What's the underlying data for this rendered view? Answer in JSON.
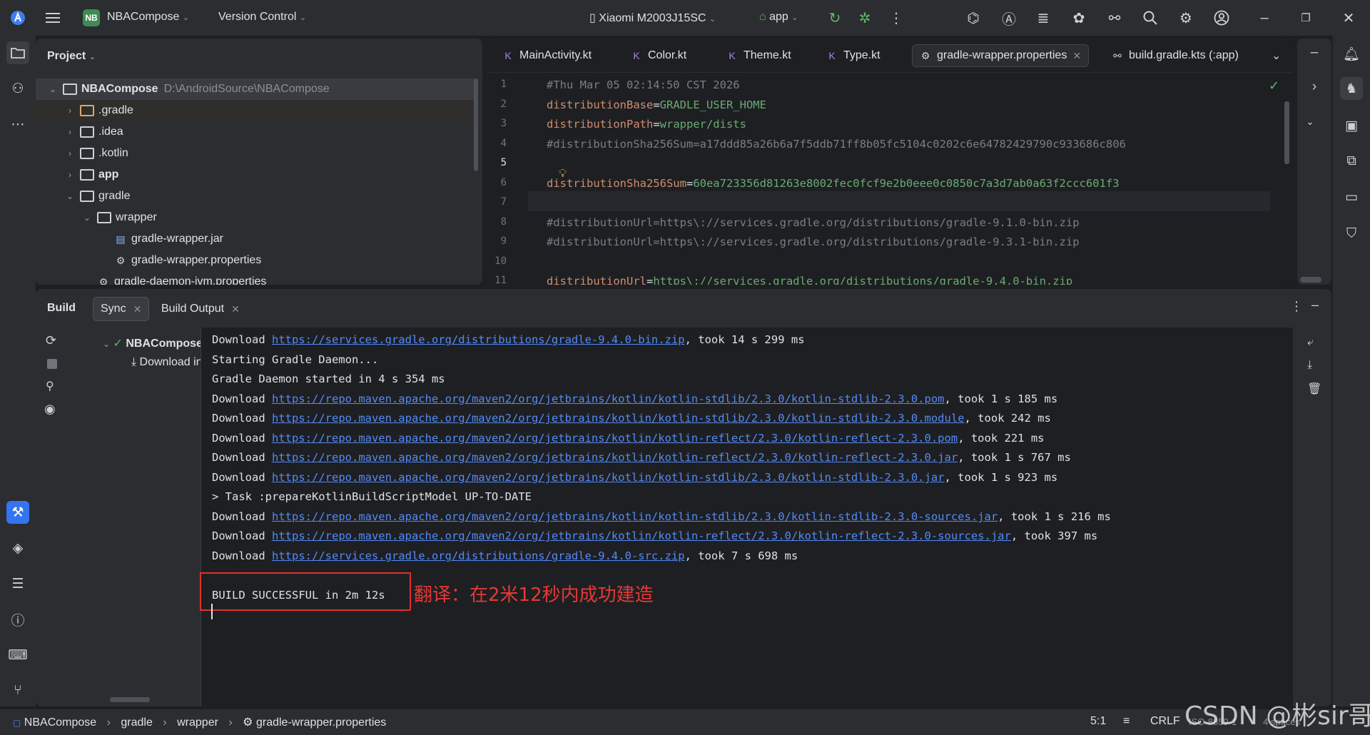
{
  "titlebar": {
    "project_badge": "NB",
    "project_name": "NBACompose",
    "vcs": "Version Control",
    "device": "Xiaomi M2003J15SC",
    "run_config": "app"
  },
  "project_panel": {
    "title": "Project",
    "root_name": "NBACompose",
    "root_path": "D:\\AndroidSource\\NBACompose",
    "items": [
      {
        "label": ".gradle"
      },
      {
        "label": ".idea"
      },
      {
        "label": ".kotlin"
      },
      {
        "label": "app"
      },
      {
        "label": "gradle"
      },
      {
        "label": "wrapper"
      },
      {
        "label": "gradle-wrapper.jar"
      },
      {
        "label": "gradle-wrapper.properties"
      },
      {
        "label": "gradle-daemon-jvm.properties"
      }
    ]
  },
  "editor": {
    "tabs": [
      {
        "label": "MainActivity.kt"
      },
      {
        "label": "Color.kt"
      },
      {
        "label": "Theme.kt"
      },
      {
        "label": "Type.kt"
      },
      {
        "label": "gradle-wrapper.properties"
      },
      {
        "label": "build.gradle.kts (:app)"
      }
    ],
    "line_numbers": [
      "1",
      "2",
      "3",
      "4",
      "5",
      "6",
      "7",
      "8",
      "9",
      "10",
      "11"
    ],
    "lines": {
      "l1": "#Thu Mar 05 02:14:50 CST 2026",
      "l2_key": "distributionBase",
      "l2_val": "GRADLE_USER_HOME",
      "l3_key": "distributionPath",
      "l3_val": "wrapper/dists",
      "l4": "#distributionSha256Sum=a17ddd85a26b6a7f5ddb71ff8b05fc5104c0202c6e64782429790c933686c806",
      "l6_key": "distributionSha256Sum",
      "l6_val": "60ea723356d81263e8002fec0fcf9e2b0eee0c0850c7a3d7ab0a63f2ccc601f3",
      "l8": "#distributionUrl=https\\://services.gradle.org/distributions/gradle-9.1.0-bin.zip",
      "l9": "#distributionUrl=https\\://services.gradle.org/distributions/gradle-9.3.1-bin.zip",
      "l11_key": "distributionUrl",
      "l11_val": "https\\://services.gradle.org/distributions/gradle-9.4.0-bin.zip"
    },
    "eq": "="
  },
  "build_panel": {
    "title": "Build",
    "tabs": [
      {
        "label": "Sync"
      },
      {
        "label": "Build Output"
      }
    ],
    "tree_root": "NBACompose: f",
    "tree_child": "Download in",
    "console": {
      "word_download": "Download",
      "l1_url": "https://services.gradle.org/distributions/gradle-9.4.0-bin.zip",
      "l1_rest": ", took 14 s 299 ms",
      "l2": "Starting Gradle Daemon...",
      "l3": "Gradle Daemon started in 4 s 354 ms",
      "l4_url": "https://repo.maven.apache.org/maven2/org/jetbrains/kotlin/kotlin-stdlib/2.3.0/kotlin-stdlib-2.3.0.pom",
      "l4_rest": ", took 1 s 185 ms",
      "l5_url": "https://repo.maven.apache.org/maven2/org/jetbrains/kotlin/kotlin-stdlib/2.3.0/kotlin-stdlib-2.3.0.module",
      "l5_rest": ", took 242 ms",
      "l6_url": "https://repo.maven.apache.org/maven2/org/jetbrains/kotlin/kotlin-reflect/2.3.0/kotlin-reflect-2.3.0.pom",
      "l6_rest": ", took 221 ms",
      "l7_url": "https://repo.maven.apache.org/maven2/org/jetbrains/kotlin/kotlin-reflect/2.3.0/kotlin-reflect-2.3.0.jar",
      "l7_rest": ", took 1 s 767 ms",
      "l8_url": "https://repo.maven.apache.org/maven2/org/jetbrains/kotlin/kotlin-stdlib/2.3.0/kotlin-stdlib-2.3.0.jar",
      "l8_rest": ", took 1 s 923 ms",
      "l9": "> Task :prepareKotlinBuildScriptModel UP-TO-DATE",
      "l10_url": "https://repo.maven.apache.org/maven2/org/jetbrains/kotlin/kotlin-stdlib/2.3.0/kotlin-stdlib-2.3.0-sources.jar",
      "l10_rest": ", took 1 s 216 ms",
      "l11_url": "https://repo.maven.apache.org/maven2/org/jetbrains/kotlin/kotlin-reflect/2.3.0/kotlin-reflect-2.3.0-sources.jar",
      "l11_rest": ", took 397 ms",
      "l12_url": "https://services.gradle.org/distributions/gradle-9.4.0-src.zip",
      "l12_rest": ", took 7 s 698 ms",
      "success": "BUILD SUCCESSFUL in 2m 12s"
    },
    "annotation": "翻译：在2米12秒内成功建造"
  },
  "statusbar": {
    "crumbs": [
      "NBACompose",
      "gradle",
      "wrapper",
      "gradle-wrapper.properties"
    ],
    "position": "5:1",
    "line_sep": "CRLF",
    "encoding": "ISO-8859-1",
    "indent": "4 spaces"
  },
  "watermark": "CSDN @彬sir哥",
  "colors": {
    "accent": "#3574f0",
    "success": "#5fb865",
    "annotation": "#e53935"
  }
}
